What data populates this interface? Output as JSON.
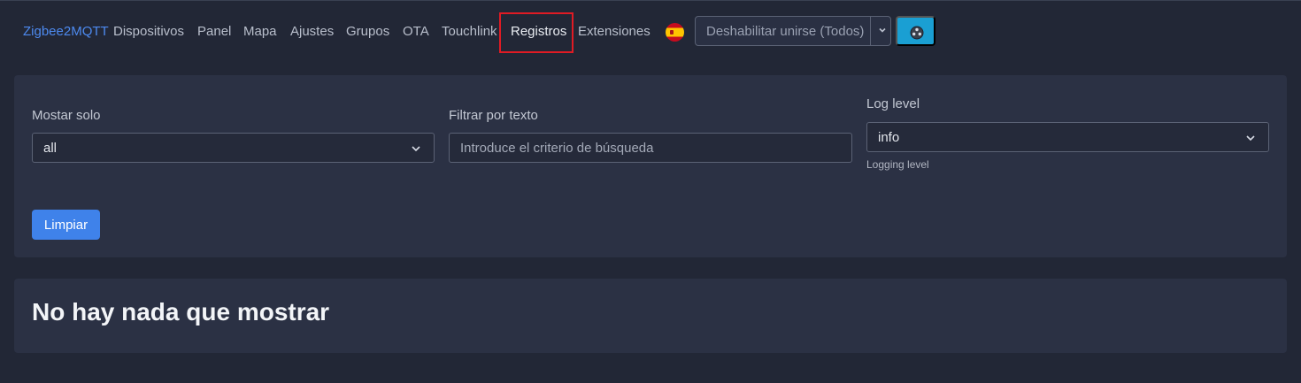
{
  "navbar": {
    "brand": "Zigbee2MQTT",
    "links": [
      "Dispositivos",
      "Panel",
      "Mapa",
      "Ajustes",
      "Grupos",
      "OTA",
      "Touchlink",
      "Registros",
      "Extensiones"
    ],
    "active_link": "Registros",
    "language_icon": "spain-flag-icon",
    "permit_join_select": "Deshabilitar unirse (Todos)",
    "theme_icon": "theme-toggle-icon"
  },
  "filters": {
    "show_only_label": "Mostar solo",
    "show_only_value": "all",
    "filter_text_label": "Filtrar por texto",
    "filter_text_placeholder": "Introduce el criterio de búsqueda",
    "log_level_label": "Log level",
    "log_level_value": "info",
    "log_level_help": "Logging level",
    "clear_button": "Limpiar"
  },
  "empty_state": {
    "message": "No hay nada que mostrar"
  },
  "colors": {
    "background": "#222736",
    "card": "#2b3144",
    "brand": "#4d8af0",
    "primary_button": "#3f82ea",
    "theme_button": "#1a9fd3",
    "active_highlight": "#e01b24"
  }
}
